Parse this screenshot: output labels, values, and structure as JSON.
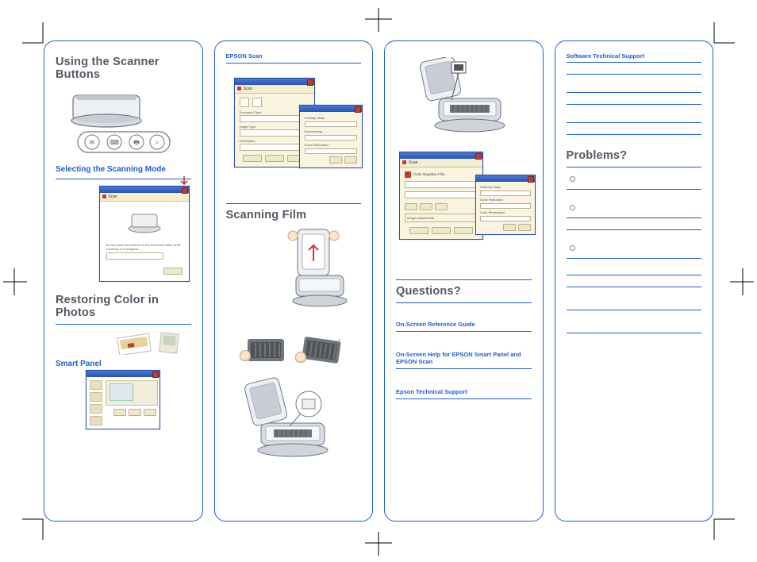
{
  "panel1": {
    "h1": "Using the Scanner Buttons",
    "h2": "Selecting the Scanning Mode",
    "h3": "Restoring Color in Photos",
    "sub1": "Smart Panel",
    "scan_app_label": "Scan"
  },
  "panel2": {
    "top": "EPSON Scan",
    "h1": "Scanning Film",
    "scan_app_label": "Scan"
  },
  "panel3": {
    "h1": "Questions?",
    "a": "On-Screen Reference Guide",
    "b": "On-Screen Help for EPSON Smart Panel and EPSON Scan",
    "c": "Epson Technical Support",
    "scan_app_label": "Scan"
  },
  "panel4": {
    "top": "Software Technical Support",
    "h1": "Problems?"
  }
}
